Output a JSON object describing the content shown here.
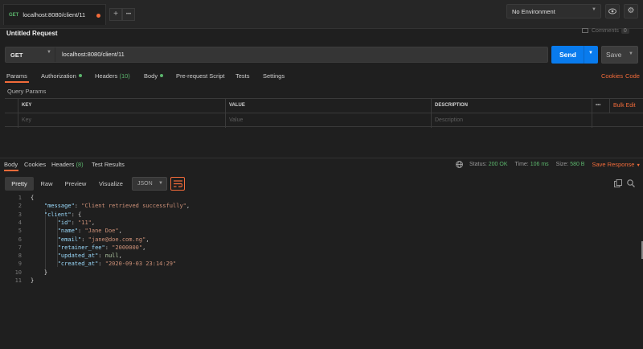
{
  "tab": {
    "method": "GET",
    "url": "localhost:8080/client/11"
  },
  "tabbar": {
    "add_icon": "+",
    "more_icon": "•••"
  },
  "environment": {
    "selected": "No Environment",
    "eye_icon": "eye-icon",
    "gear_icon": "gear-icon"
  },
  "request": {
    "title": "Untitled Request",
    "comments_label": "Comments",
    "comments_count": "0",
    "method": "GET",
    "url": "localhost:8080/client/11",
    "send_label": "Send",
    "save_label": "Save"
  },
  "request_tabs": [
    {
      "label": "Params",
      "count": "",
      "dot": false
    },
    {
      "label": "Authorization",
      "count": "",
      "dot": true
    },
    {
      "label": "Headers",
      "count": "(10)",
      "dot": false
    },
    {
      "label": "Body",
      "count": "",
      "dot": true
    },
    {
      "label": "Pre-request Script",
      "count": "",
      "dot": false
    },
    {
      "label": "Tests",
      "count": "",
      "dot": false
    },
    {
      "label": "Settings",
      "count": "",
      "dot": false
    }
  ],
  "request_links": {
    "cookies": "Cookies",
    "code": "Code"
  },
  "query_params": {
    "label": "Query Params",
    "headers": [
      "KEY",
      "VALUE",
      "DESCRIPTION"
    ],
    "bulk_edit": "Bulk Edit",
    "more_icon": "•••",
    "placeholders": [
      "Key",
      "Value",
      "Description"
    ]
  },
  "response_tabs": [
    {
      "label": "Body",
      "count": ""
    },
    {
      "label": "Cookies",
      "count": ""
    },
    {
      "label": "Headers",
      "count": "(8)"
    },
    {
      "label": "Test Results",
      "count": ""
    }
  ],
  "response_meta": {
    "status_label": "Status:",
    "status_value": "200 OK",
    "time_label": "Time:",
    "time_value": "106 ms",
    "size_label": "Size:",
    "size_value": "580 B",
    "save_response": "Save Response"
  },
  "format_bar": {
    "pretty": "Pretty",
    "raw": "Raw",
    "preview": "Preview",
    "visualize": "Visualize",
    "format": "JSON"
  },
  "code_lines": [
    "{",
    "    \"message\": \"Client retrieved successfully\",",
    "    \"client\": {",
    "        \"id\": \"11\",",
    "        \"name\": \"Jane Doe\",",
    "        \"email\": \"jane@doe.com.ng\",",
    "        \"retainer_fee\": \"2000000\",",
    "        \"updated_at\": null,",
    "        \"created_at\": \"2020-09-03 23:14:29\"",
    "    }",
    "}"
  ],
  "colors": {
    "accent": "#f26b3a",
    "send": "#097bed",
    "success": "#5bb56c"
  }
}
